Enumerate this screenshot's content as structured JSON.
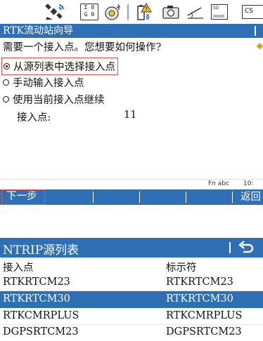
{
  "colors": {
    "accent": "#2f6fb4",
    "highlight_border": "#e0554f"
  },
  "status_bar": {
    "icons": [
      "satellite-icon",
      "sv-count-icon",
      "radio-link-icon",
      "battery-warning-icon",
      "camera-icon",
      "tilt-icon",
      "sd-card-icon",
      "cs-icon"
    ],
    "sv_top": "Σ 0",
    "sv_bottom": "G 0",
    "sd_label": "SD",
    "cs_label": "CS"
  },
  "wizard": {
    "title": "RTK流动站向导",
    "question": "需要一个接入点。您想要如何操作?",
    "options": [
      {
        "label": "从源列表中选择接入点",
        "selected": true
      },
      {
        "label": "手动输入接入点",
        "selected": false
      },
      {
        "label": "使用当前接入点继续",
        "selected": false
      }
    ],
    "access_point_label": "接入点:",
    "access_point_value": "11",
    "info_line": {
      "keys": "Fn  abc",
      "time": "10:"
    },
    "softkeys": {
      "next": "下一步",
      "back": "返回"
    }
  },
  "ntrip": {
    "title": "NTRIP源列表",
    "columns": [
      "接入点",
      "标示符"
    ],
    "rows": [
      {
        "mountpoint": "RTKRTCM23",
        "identifier": "RTKRTCM23",
        "selected": false
      },
      {
        "mountpoint": "RTKRTCM30",
        "identifier": "RTKRTCM30",
        "selected": true
      },
      {
        "mountpoint": "RTKCMRPLUS",
        "identifier": "RTKCMRPLUS",
        "selected": false
      },
      {
        "mountpoint": "DGPSRTCM23",
        "identifier": "DGPSRTCM23",
        "selected": false
      }
    ]
  }
}
